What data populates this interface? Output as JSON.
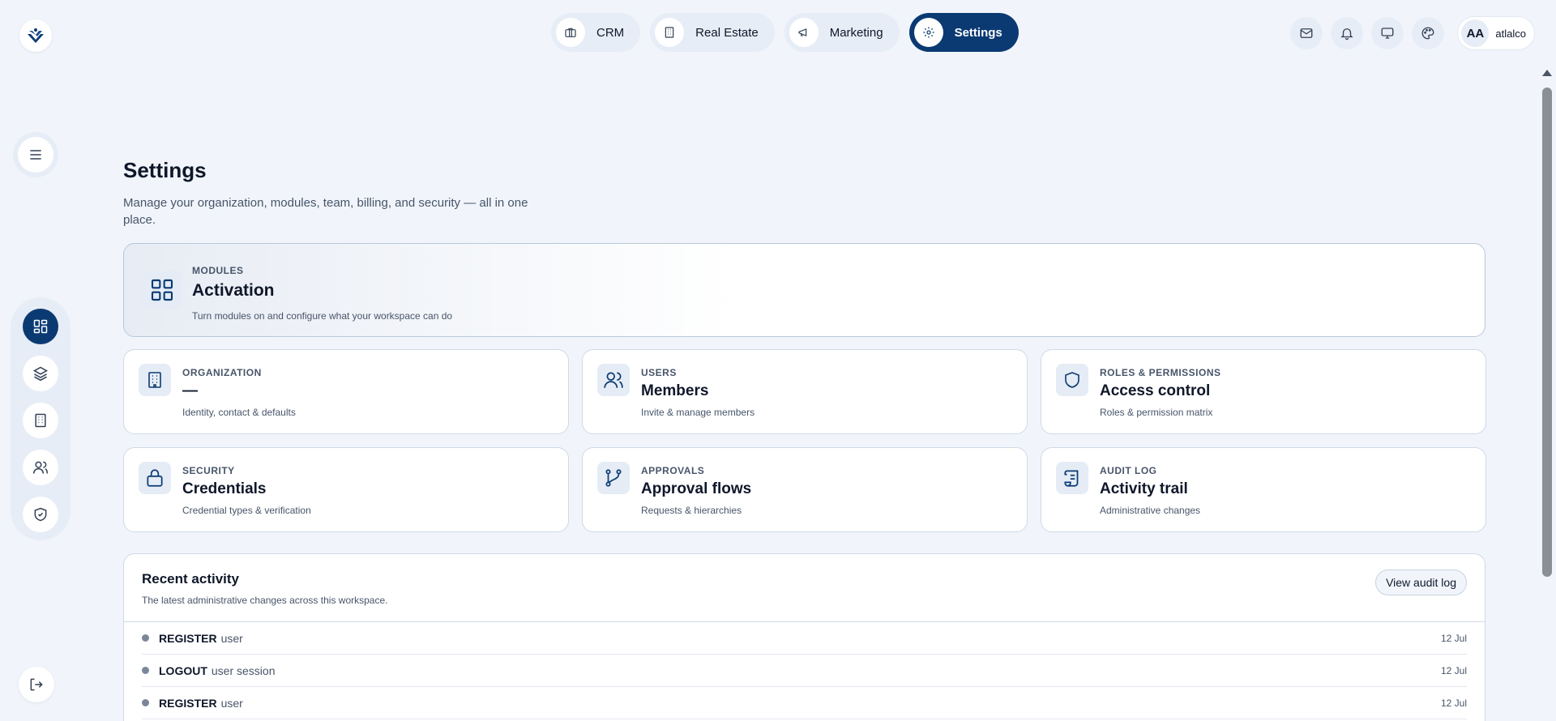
{
  "top_nav": {
    "items": [
      {
        "label": "CRM",
        "icon": "briefcase-icon"
      },
      {
        "label": "Real Estate",
        "icon": "building-icon"
      },
      {
        "label": "Marketing",
        "icon": "megaphone-icon"
      },
      {
        "label": "Settings",
        "icon": "gear-icon",
        "active": true
      }
    ]
  },
  "top_right": {
    "icons": [
      "mail-icon",
      "bell-icon",
      "monitor-icon",
      "palette-icon"
    ],
    "user": {
      "initials": "AA",
      "name": "atlalco"
    }
  },
  "side_rail": {
    "icons": [
      "dashboard-icon",
      "layers-icon",
      "building-icon",
      "users-icon",
      "shield-check-icon"
    ],
    "logout_icon": "logout-icon"
  },
  "page": {
    "title": "Settings",
    "subtitle": "Manage your organization, modules, team, billing, and security — all in one place."
  },
  "modules_card": {
    "eyebrow": "MODULES",
    "title": "Activation",
    "desc": "Turn modules on and configure what your workspace can do",
    "icon": "grid-icon"
  },
  "cards": [
    {
      "eyebrow": "ORGANIZATION",
      "title": "—",
      "desc": "Identity, contact & defaults",
      "icon": "building-icon"
    },
    {
      "eyebrow": "USERS",
      "title": "Members",
      "desc": "Invite & manage members",
      "icon": "users-icon"
    },
    {
      "eyebrow": "ROLES & PERMISSIONS",
      "title": "Access control",
      "desc": "Roles & permission matrix",
      "icon": "shield-icon"
    },
    {
      "eyebrow": "SECURITY",
      "title": "Credentials",
      "desc": "Credential types & verification",
      "icon": "lock-icon"
    },
    {
      "eyebrow": "APPROVALS",
      "title": "Approval flows",
      "desc": "Requests & hierarchies",
      "icon": "git-branch-icon"
    },
    {
      "eyebrow": "AUDIT LOG",
      "title": "Activity trail",
      "desc": "Administrative changes",
      "icon": "scroll-icon"
    }
  ],
  "activity": {
    "title": "Recent activity",
    "subtitle": "The latest administrative changes across this workspace.",
    "button": "View audit log",
    "rows": [
      {
        "verb": "REGISTER",
        "object": "user",
        "date": "12 Jul"
      },
      {
        "verb": "LOGOUT",
        "object": "user session",
        "date": "12 Jul"
      },
      {
        "verb": "REGISTER",
        "object": "user",
        "date": "12 Jul"
      }
    ]
  },
  "colors": {
    "accent": "#0b3a73",
    "background": "#f1f5fb",
    "pill": "#e7edf6"
  }
}
